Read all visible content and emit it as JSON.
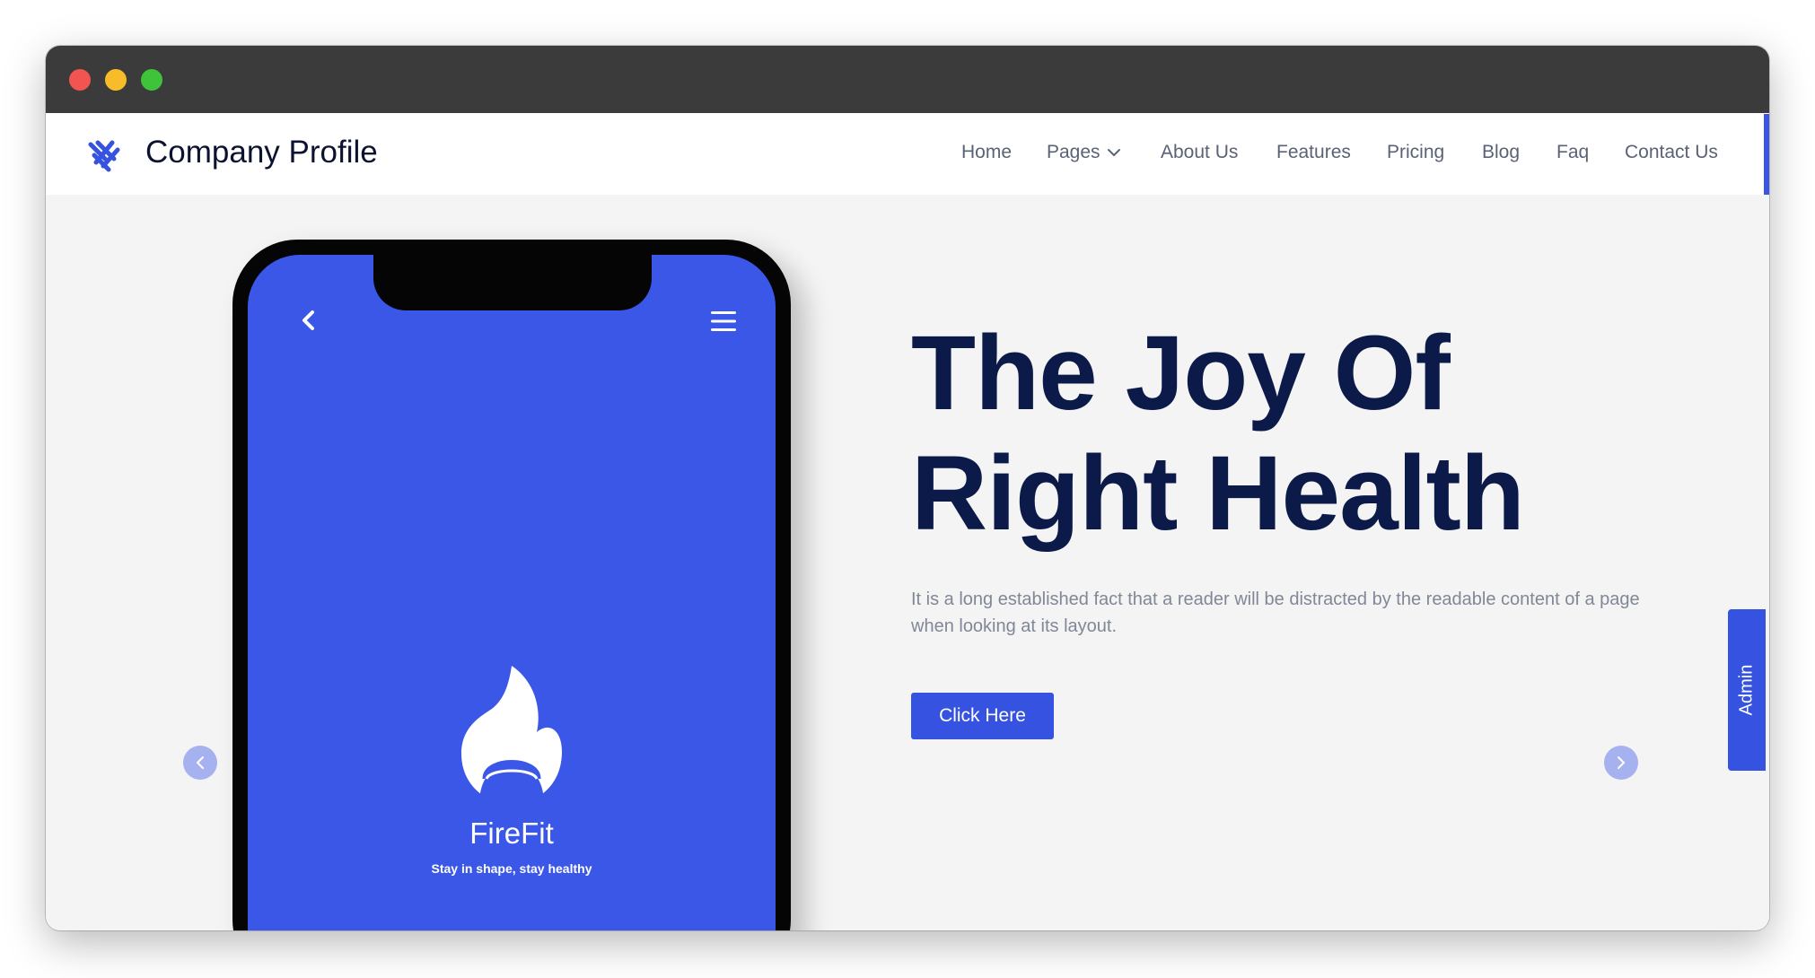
{
  "window": {
    "controls": [
      "close",
      "minimize",
      "zoom"
    ],
    "colors": {
      "close": "#f25451",
      "minimize": "#f7bc2a",
      "zoom": "#3fc33a",
      "titlebar": "#3b3b3b"
    }
  },
  "navbar": {
    "brand": "Company Profile",
    "logo_icon": "logo-mark-icon",
    "items": [
      {
        "label": "Home"
      },
      {
        "label": "Pages",
        "has_dropdown": true
      },
      {
        "label": "About Us"
      },
      {
        "label": "Features"
      },
      {
        "label": "Pricing"
      },
      {
        "label": "Blog"
      },
      {
        "label": "Faq"
      },
      {
        "label": "Contact Us"
      }
    ]
  },
  "hero": {
    "title_line1": "The Joy Of",
    "title_line2": "Right Health",
    "description": "It is a long established fact that a reader will be distracted by the readable content of a page when looking at its layout.",
    "cta_label": "Click Here"
  },
  "phone": {
    "app_name": "FireFit",
    "app_tagline": "Stay in shape, stay healthy",
    "icons": [
      "back-icon",
      "menu-icon",
      "flame-kettlebell-icon"
    ]
  },
  "admin_tab": {
    "label": "Admin"
  },
  "colors": {
    "accent": "#3552e0",
    "phone_screen": "#3b57e8",
    "title_text": "#0b1a48",
    "body_text": "#808796",
    "carousel_button": "#a5b2ef"
  }
}
